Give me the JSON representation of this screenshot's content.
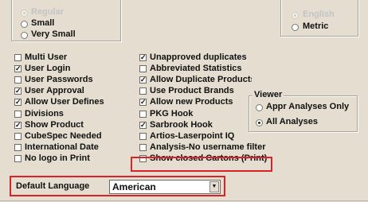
{
  "units": {
    "options": [
      {
        "label": "Regular",
        "selected": true,
        "disabled": true
      },
      {
        "label": "Small",
        "selected": false,
        "disabled": false
      },
      {
        "label": "Very Small",
        "selected": false,
        "disabled": false
      }
    ]
  },
  "measure": {
    "options": [
      {
        "label": "English",
        "selected": true,
        "disabled": true
      },
      {
        "label": "Metric",
        "selected": false,
        "disabled": false
      }
    ]
  },
  "left_checks": [
    {
      "label": "Multi User",
      "checked": false
    },
    {
      "label": "User Login",
      "checked": true
    },
    {
      "label": "User Passwords",
      "checked": false
    },
    {
      "label": "User Approval",
      "checked": true
    },
    {
      "label": "Allow User Defines",
      "checked": true
    },
    {
      "label": "Divisions",
      "checked": false
    },
    {
      "label": "Show Product",
      "checked": true
    },
    {
      "label": "CubeSpec Needed",
      "checked": false
    },
    {
      "label": "International Date",
      "checked": false
    },
    {
      "label": "No logo in Print",
      "checked": false
    }
  ],
  "right_checks": [
    {
      "label": "Unapproved duplicates",
      "checked": true
    },
    {
      "label": "Abbreviated Statistics",
      "checked": false
    },
    {
      "label": "Allow Duplicate Products",
      "checked": true
    },
    {
      "label": "Use Product Brands",
      "checked": false
    },
    {
      "label": "Allow new Products",
      "checked": true
    },
    {
      "label": "PKG Hook",
      "checked": false
    },
    {
      "label": "Sarbrook Hook",
      "checked": true
    },
    {
      "label": "Artios-Laserpoint IQ",
      "checked": false
    },
    {
      "label": "Analysis-No username filter",
      "checked": false
    },
    {
      "label": "Show closed Cartons (Print)",
      "checked": false
    }
  ],
  "viewer": {
    "title": "Viewer",
    "options": [
      {
        "label": "Appr Analyses Only",
        "selected": false
      },
      {
        "label": "All Analyses",
        "selected": true
      }
    ]
  },
  "default_language": {
    "label": "Default Language",
    "value": "American"
  },
  "colors": {
    "background": "#e4ddd0",
    "highlight": "#d9232b"
  }
}
